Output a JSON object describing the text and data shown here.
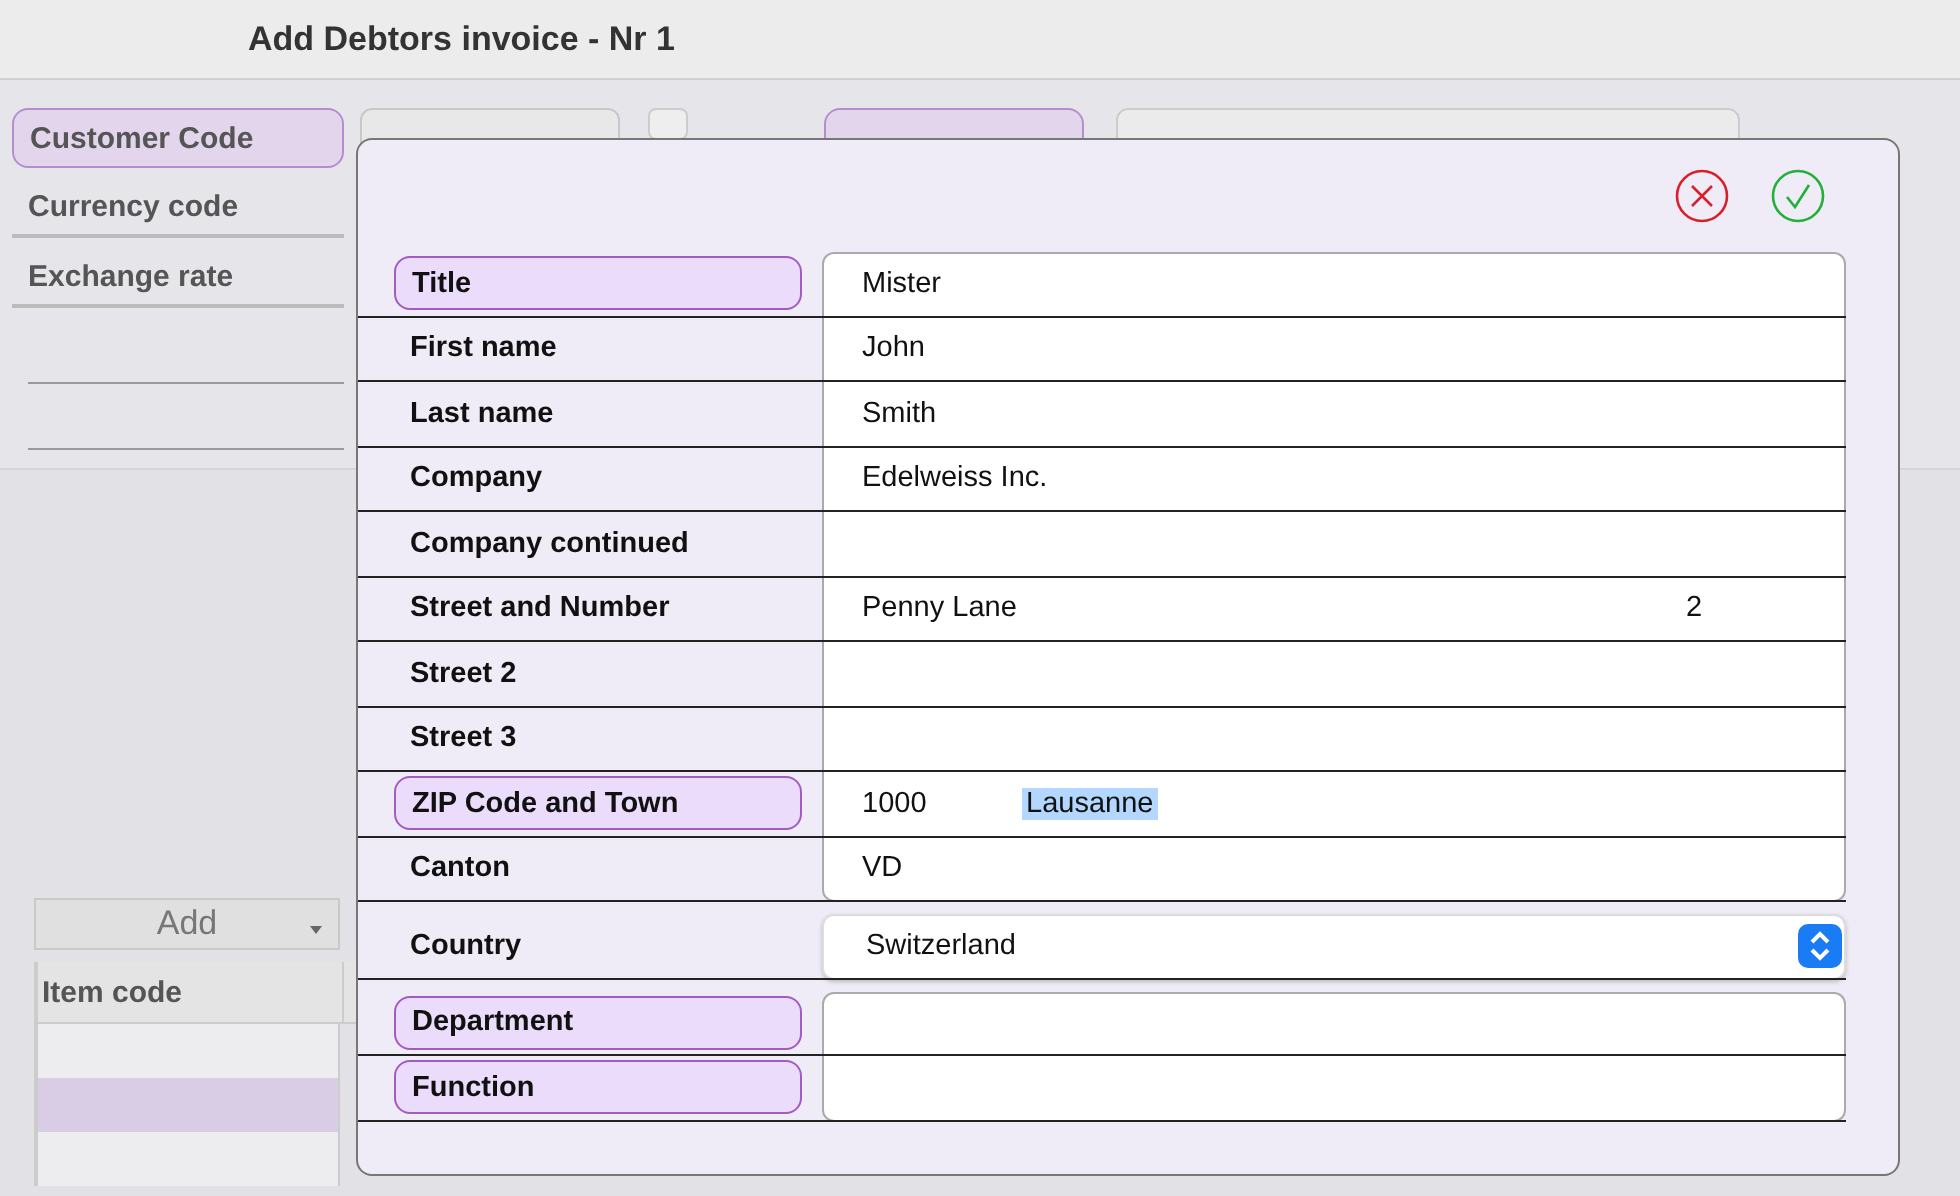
{
  "window": {
    "title": "Add Debtors invoice - Nr 1"
  },
  "header_fields": [
    {
      "label": "Customer Code",
      "highlighted": true
    },
    {
      "label": "Currency code",
      "highlighted": false
    },
    {
      "label": "Exchange rate",
      "highlighted": false
    }
  ],
  "lsv_checkbox": {
    "checked": false
  },
  "address": {
    "highlighted": true
  },
  "add_button": {
    "label": "Add"
  },
  "table": {
    "columns": [
      "Item code"
    ],
    "rows": [
      {
        "selected": false
      },
      {
        "selected": true
      },
      {
        "selected": false
      }
    ]
  },
  "dialog": {
    "groups": [
      {
        "rows": [
          {
            "label": "Title",
            "highlighted": true,
            "fields": [
              {
                "value": "Mister"
              }
            ]
          },
          {
            "label": "First name",
            "highlighted": false,
            "fields": [
              {
                "value": "John"
              }
            ]
          },
          {
            "label": "Last name",
            "highlighted": false,
            "fields": [
              {
                "value": "Smith"
              }
            ]
          },
          {
            "label": "Company",
            "highlighted": false,
            "fields": [
              {
                "value": "Edelweiss Inc."
              }
            ]
          },
          {
            "label": "Company continued",
            "highlighted": false
          },
          {
            "label": "Street and Number",
            "highlighted": false,
            "fields": [
              {
                "value": "Penny Lane"
              },
              {
                "value": "2",
                "kind": "short"
              }
            ]
          },
          {
            "label": "Street 2",
            "highlighted": false
          },
          {
            "label": "Street 3",
            "highlighted": false
          },
          {
            "label": "ZIP Code and Town",
            "highlighted": true,
            "fields": [
              {
                "value": "1000",
                "kind": "zip"
              },
              {
                "value": "Lausanne",
                "selected": true
              }
            ]
          },
          {
            "label": "Canton",
            "highlighted": false,
            "fields": [
              {
                "value": "VD"
              }
            ]
          }
        ]
      },
      {
        "kind": "select",
        "rows": [
          {
            "label": "Country",
            "highlighted": false,
            "fields": [
              {
                "value": "Switzerland"
              }
            ]
          }
        ]
      },
      {
        "rows": [
          {
            "label": "Department",
            "highlighted": true
          },
          {
            "label": "Function",
            "highlighted": true
          }
        ]
      }
    ]
  }
}
